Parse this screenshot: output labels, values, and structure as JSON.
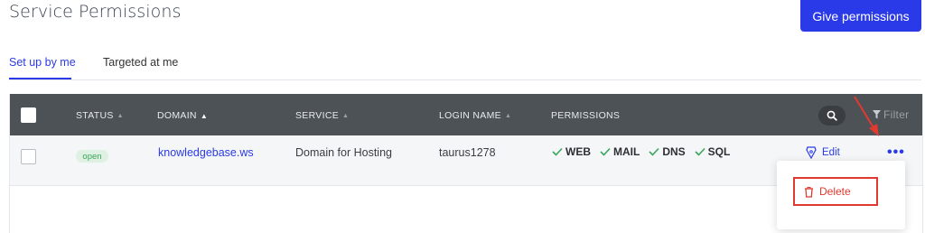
{
  "header": {
    "title": "Service Permissions",
    "give_permissions_label": "Give permissions"
  },
  "tabs": [
    {
      "label": "Set up by me",
      "active": true
    },
    {
      "label": "Targeted at me",
      "active": false
    }
  ],
  "table": {
    "columns": [
      {
        "label": "STATUS",
        "sortable": true,
        "sorted": false
      },
      {
        "label": "DOMAIN",
        "sortable": true,
        "sorted": true
      },
      {
        "label": "SERVICE",
        "sortable": true,
        "sorted": false
      },
      {
        "label": "LOGIN NAME",
        "sortable": true,
        "sorted": false
      },
      {
        "label": "PERMISSIONS",
        "sortable": false,
        "sorted": false
      }
    ],
    "filter_label": "Filter",
    "rows": [
      {
        "status": "open",
        "domain": "knowledgebase.ws",
        "service": "Domain for Hosting",
        "login_name": "taurus1278",
        "permissions": [
          "WEB",
          "MAIL",
          "DNS",
          "SQL"
        ],
        "edit_label": "Edit",
        "more_label": "•••"
      }
    ]
  },
  "dropdown": {
    "delete_label": "Delete"
  },
  "colors": {
    "accent": "#2b3ae8",
    "header_bg": "#4d5257",
    "status_open_bg": "#dff1e3",
    "status_open_text": "#3aa55c",
    "check": "#3aa55c",
    "delete": "#e03a2f"
  }
}
